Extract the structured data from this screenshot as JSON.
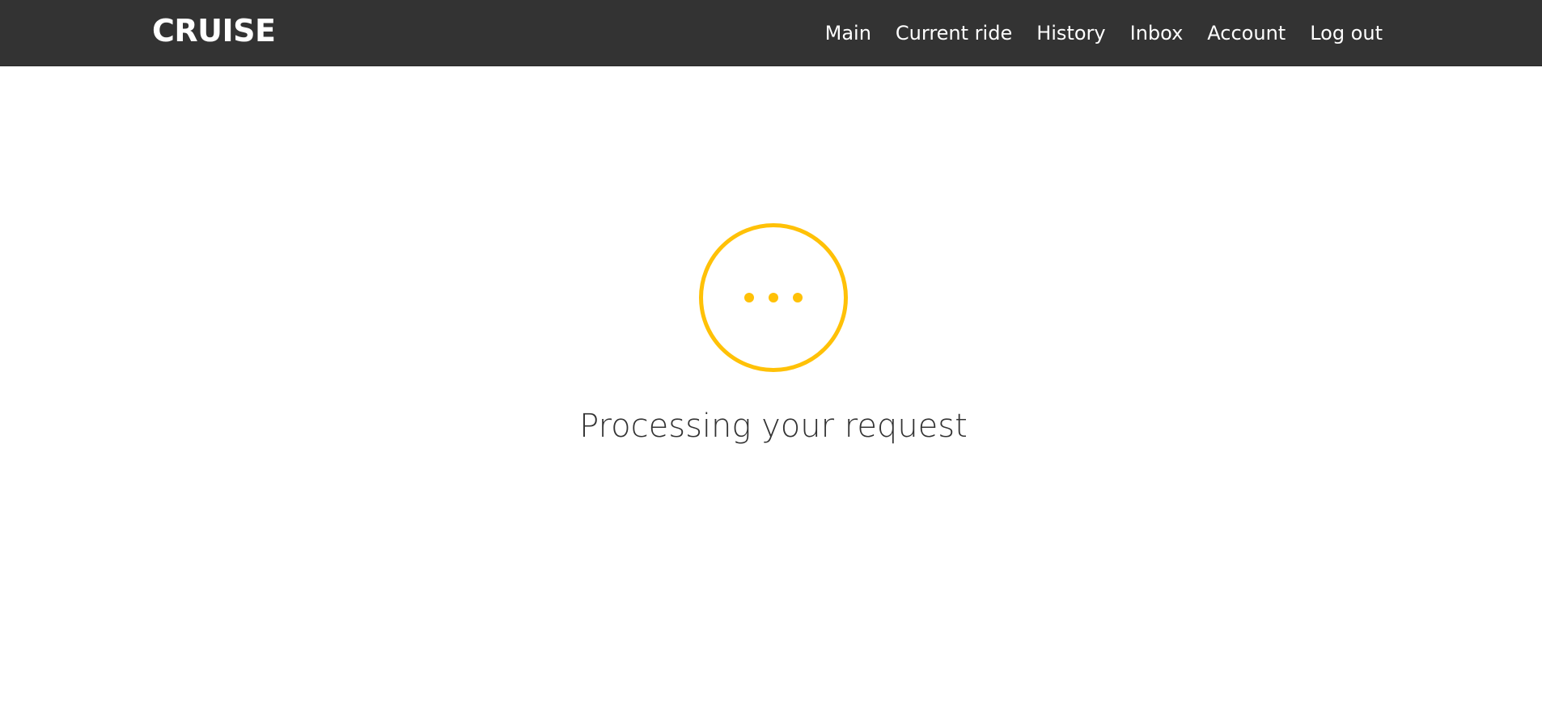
{
  "header": {
    "brand": "CRUISE",
    "nav_items": [
      {
        "label": "Main"
      },
      {
        "label": "Current ride"
      },
      {
        "label": "History"
      },
      {
        "label": "Inbox"
      },
      {
        "label": "Account"
      },
      {
        "label": "Log out"
      }
    ]
  },
  "main": {
    "status_icon": "ellipsis-circle-icon",
    "status_message": "Processing your request"
  },
  "colors": {
    "navbar_background": "#333333",
    "accent": "#FFC107",
    "text": "#333333"
  }
}
